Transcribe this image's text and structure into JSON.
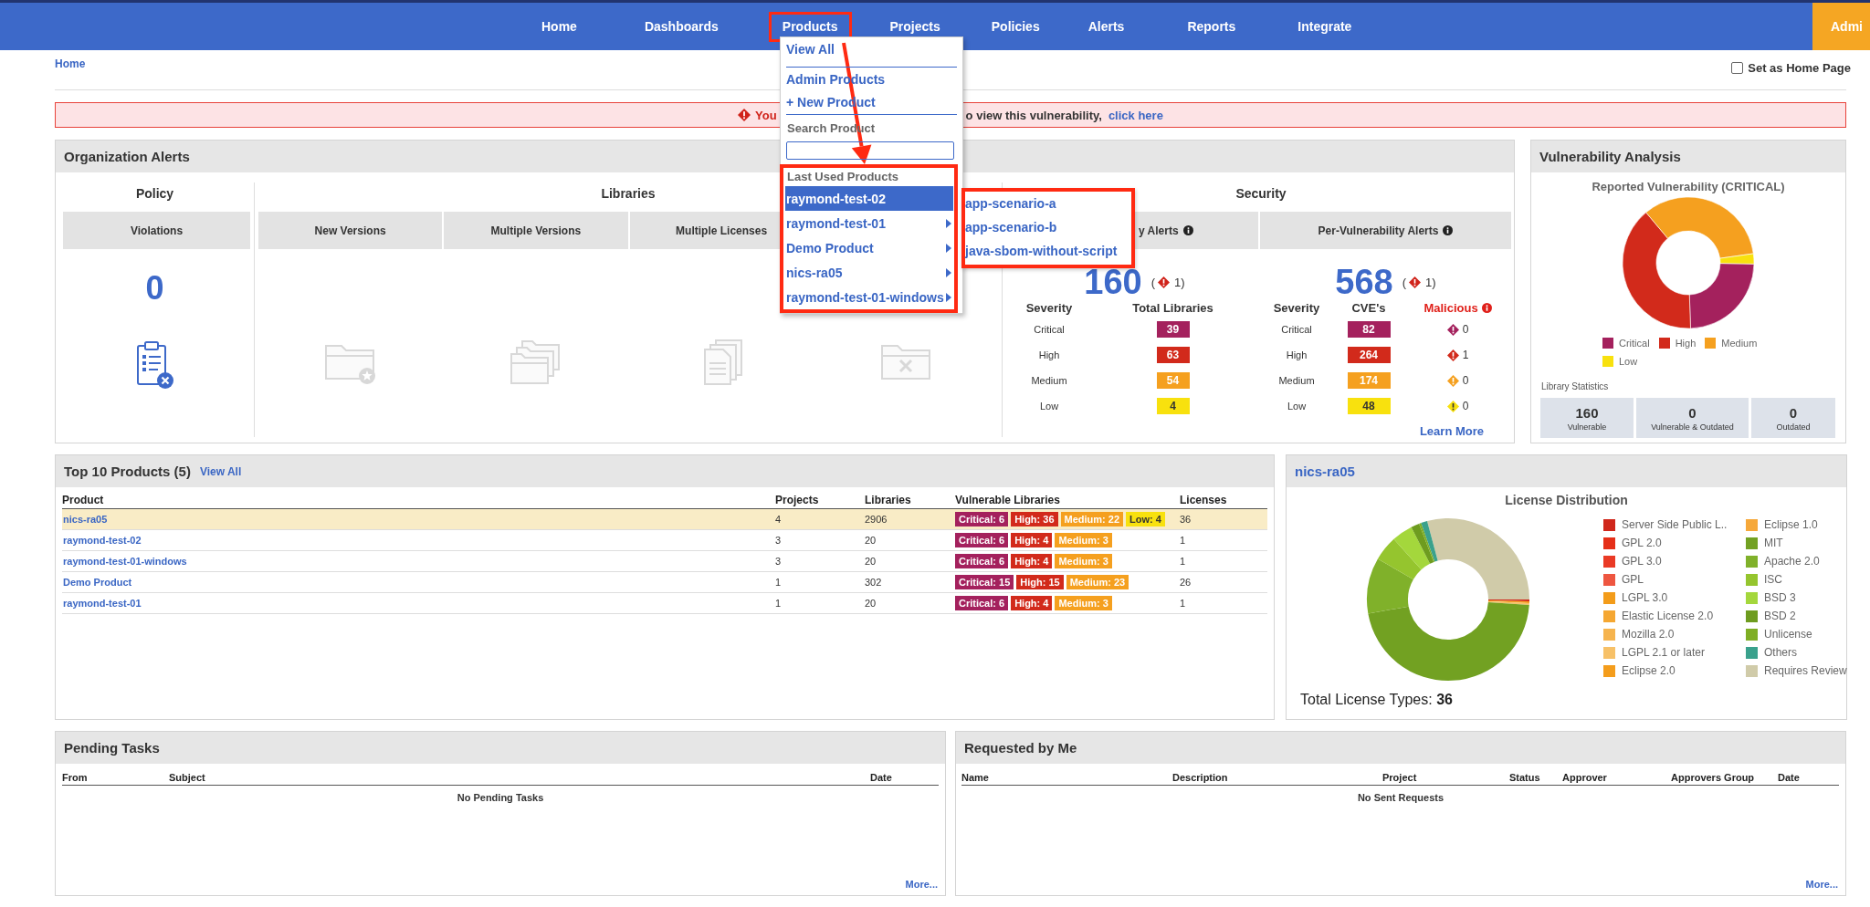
{
  "nav": {
    "items": [
      {
        "label": "Home",
        "highlighted": false
      },
      {
        "label": "Dashboards",
        "highlighted": false
      },
      {
        "label": "Products",
        "highlighted": true
      },
      {
        "label": "Projects",
        "highlighted": false
      },
      {
        "label": "Policies",
        "highlighted": false
      },
      {
        "label": "Alerts",
        "highlighted": false
      },
      {
        "label": "Reports",
        "highlighted": false
      },
      {
        "label": "Integrate",
        "highlighted": false
      }
    ],
    "admin_button": "Admi"
  },
  "products_menu": {
    "links": [
      "View All",
      "Admin Products",
      "+ New Product"
    ],
    "search_label": "Search Product",
    "recent_label": "Last Used Products",
    "recent_highlighted": true,
    "recent": [
      {
        "label": "raymond-test-02",
        "selected": true
      },
      {
        "label": "raymond-test-01",
        "selected": false
      },
      {
        "label": "Demo Product",
        "selected": false
      },
      {
        "label": "nics-ra05",
        "selected": false
      },
      {
        "label": "raymond-test-01-windows",
        "selected": false
      }
    ]
  },
  "submenu": {
    "highlighted": true,
    "items": [
      "app-scenario-a",
      "app-scenario-b",
      "java-sbom-without-script"
    ]
  },
  "breadcrumb": "Home",
  "home_page_checkbox": {
    "label": "Set as Home Page",
    "checked": false
  },
  "alert_banner": {
    "text_before": "You",
    "text_after": "o view this vulnerability,",
    "link": "click here"
  },
  "organization_alerts": {
    "title": "Organization Alerts",
    "policy": {
      "heading": "Policy",
      "column": "Violations",
      "count": "0"
    },
    "libraries": {
      "heading": "Libraries",
      "columns": [
        "New Versions",
        "Multiple Versions",
        "Multiple Licenses"
      ]
    },
    "security": {
      "heading": "Security",
      "groups": [
        {
          "header": "y Alerts",
          "total": "160",
          "alert_prefix": "(",
          "alert_suffix": "1)",
          "columns": [
            "Severity",
            "Total Libraries"
          ],
          "rows": [
            {
              "severity": "Critical",
              "count": "39",
              "color": "#a4215d"
            },
            {
              "severity": "High",
              "count": "63",
              "color": "#d22a1b"
            },
            {
              "severity": "Medium",
              "count": "54",
              "color": "#f5a01f"
            },
            {
              "severity": "Low",
              "count": "4",
              "color": "#f8e10e"
            }
          ]
        },
        {
          "header": "Per-Vulnerability Alerts",
          "total": "568",
          "alert_prefix": "(",
          "alert_suffix": "1)",
          "columns": [
            "Severity",
            "CVE's",
            "Malicious"
          ],
          "rows": [
            {
              "severity": "Critical",
              "count": "82",
              "malicious": "0",
              "color": "#a4215d"
            },
            {
              "severity": "High",
              "count": "264",
              "malicious": "1",
              "color": "#d22a1b"
            },
            {
              "severity": "Medium",
              "count": "174",
              "malicious": "0",
              "color": "#f5a01f"
            },
            {
              "severity": "Low",
              "count": "48",
              "malicious": "0",
              "color": "#f8e10e"
            }
          ]
        }
      ],
      "learn_more": "Learn More"
    }
  },
  "vulnerability_analysis": {
    "title": "Vulnerability Analysis",
    "chart_title": "Reported Vulnerability (CRITICAL)",
    "legend": [
      {
        "label": "Critical",
        "color": "#a4215d"
      },
      {
        "label": "High",
        "color": "#d22a1b"
      },
      {
        "label": "Medium",
        "color": "#f5a01f"
      },
      {
        "label": "Low",
        "color": "#f8e10e"
      }
    ],
    "stats_label": "Library Statistics",
    "stats": [
      {
        "value": "160",
        "label": "Vulnerable"
      },
      {
        "value": "0",
        "label": "Vulnerable & Outdated"
      },
      {
        "value": "0",
        "label": "Outdated"
      }
    ]
  },
  "top_products": {
    "title": "Top 10 Products (5)",
    "view_all": "View All",
    "columns": [
      "Product",
      "Projects",
      "Libraries",
      "Vulnerable Libraries",
      "Licenses"
    ],
    "rows": [
      {
        "product": "nics-ra05",
        "projects": "4",
        "libraries": "2906",
        "vulnerable": [
          {
            "label": "Critical: 6",
            "color": "#a4215d"
          },
          {
            "label": "High: 36",
            "color": "#d22a1b"
          },
          {
            "label": "Medium: 22",
            "color": "#f5a01f"
          },
          {
            "label": "Low: 4",
            "color": "#f8e10e"
          }
        ],
        "licenses": "36",
        "selected": true
      },
      {
        "product": "raymond-test-02",
        "projects": "3",
        "libraries": "20",
        "vulnerable": [
          {
            "label": "Critical: 6",
            "color": "#a4215d"
          },
          {
            "label": "High: 4",
            "color": "#d22a1b"
          },
          {
            "label": "Medium: 3",
            "color": "#f5a01f"
          }
        ],
        "licenses": "1",
        "selected": false
      },
      {
        "product": "raymond-test-01-windows",
        "projects": "3",
        "libraries": "20",
        "vulnerable": [
          {
            "label": "Critical: 6",
            "color": "#a4215d"
          },
          {
            "label": "High: 4",
            "color": "#d22a1b"
          },
          {
            "label": "Medium: 3",
            "color": "#f5a01f"
          }
        ],
        "licenses": "1",
        "selected": false
      },
      {
        "product": "Demo Product",
        "projects": "1",
        "libraries": "302",
        "vulnerable": [
          {
            "label": "Critical: 15",
            "color": "#a4215d"
          },
          {
            "label": "High: 15",
            "color": "#d22a1b"
          },
          {
            "label": "Medium: 23",
            "color": "#f5a01f"
          }
        ],
        "licenses": "26",
        "selected": false
      },
      {
        "product": "raymond-test-01",
        "projects": "1",
        "libraries": "20",
        "vulnerable": [
          {
            "label": "Critical: 6",
            "color": "#a4215d"
          },
          {
            "label": "High: 4",
            "color": "#d22a1b"
          },
          {
            "label": "Medium: 3",
            "color": "#f5a01f"
          }
        ],
        "licenses": "1",
        "selected": false
      }
    ]
  },
  "license_panel": {
    "title": "nics-ra05",
    "chart_title": "License Distribution",
    "legend": [
      {
        "label": "Server Side Public L..",
        "color": "#d0271b"
      },
      {
        "label": "GPL 2.0",
        "color": "#e52f18"
      },
      {
        "label": "GPL 3.0",
        "color": "#ea3a25"
      },
      {
        "label": "GPL",
        "color": "#ee5640"
      },
      {
        "label": "LGPL 3.0",
        "color": "#f39c1a"
      },
      {
        "label": "Elastic License 2.0",
        "color": "#f5a732"
      },
      {
        "label": "Mozilla 2.0",
        "color": "#f6b44e"
      },
      {
        "label": "LGPL 2.1 or later",
        "color": "#f7c168"
      },
      {
        "label": "Eclipse 2.0",
        "color": "#f49d1c"
      },
      {
        "label": "Eclipse 1.0",
        "color": "#f6a83a"
      },
      {
        "label": "MIT",
        "color": "#72a122"
      },
      {
        "label": "Apache 2.0",
        "color": "#80b12a"
      },
      {
        "label": "ISC",
        "color": "#95c52e"
      },
      {
        "label": "BSD 3",
        "color": "#a4d73c"
      },
      {
        "label": "BSD 2",
        "color": "#6e9c1f"
      },
      {
        "label": "Unlicense",
        "color": "#7fae24"
      },
      {
        "label": "Others",
        "color": "#3aa18c"
      },
      {
        "label": "Requires Review",
        "color": "#d0cba9"
      }
    ],
    "total": "Total License Types: **36**"
  },
  "pending_tasks": {
    "title": "Pending Tasks",
    "columns": [
      "From",
      "Subject",
      "Date"
    ],
    "empty": "No Pending Tasks",
    "more": "More..."
  },
  "requested_by_me": {
    "title": "Requested by Me",
    "columns": [
      "Name",
      "Description",
      "Project",
      "Status",
      "Approver",
      "Approvers Group",
      "Date"
    ],
    "empty": "No Sent Requests",
    "more": "More..."
  }
}
